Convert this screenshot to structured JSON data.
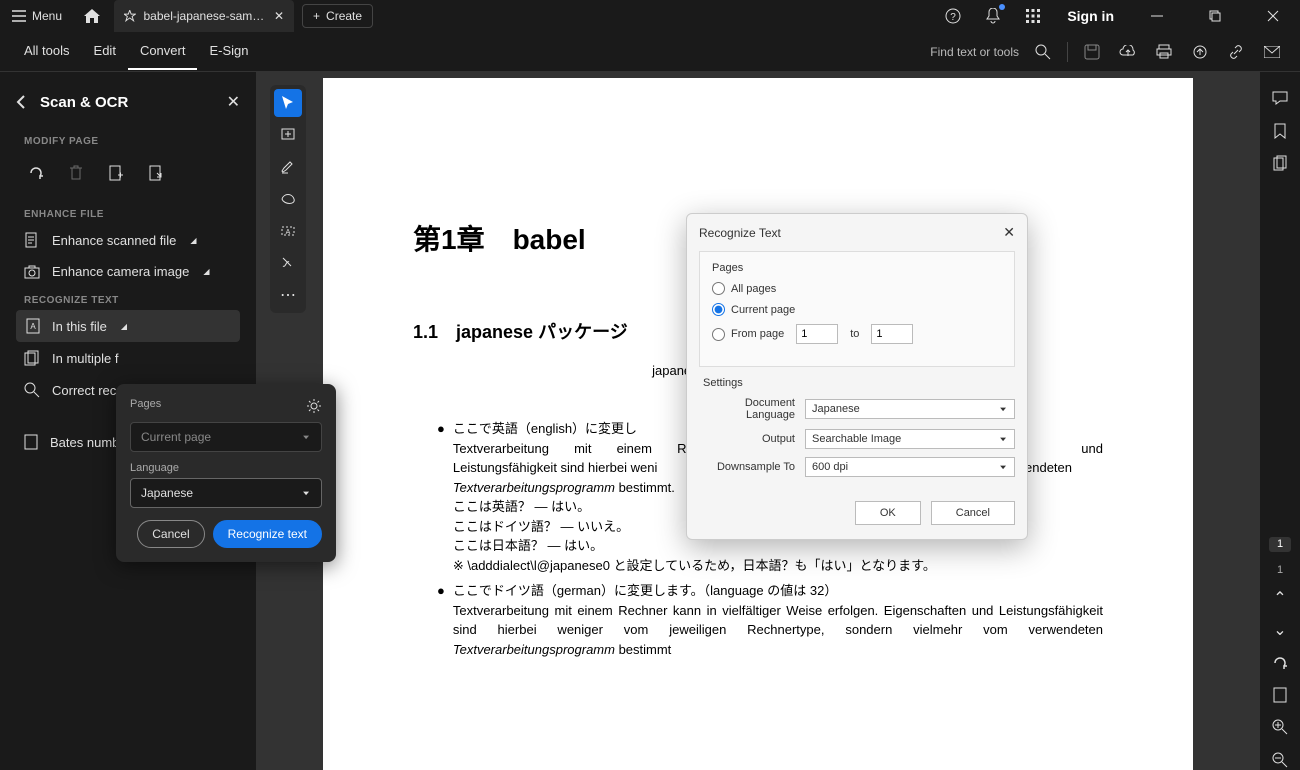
{
  "titlebar": {
    "menu": "Menu",
    "tab_title": "babel-japanese-sample.",
    "create": "Create",
    "signin": "Sign in"
  },
  "toolbar": {
    "tabs": [
      "All tools",
      "Edit",
      "Convert",
      "E-Sign"
    ],
    "find": "Find text or tools"
  },
  "sidebar": {
    "title": "Scan & OCR",
    "modify_label": "MODIFY PAGE",
    "enhance_label": "ENHANCE FILE",
    "enhance_scanned": "Enhance scanned file",
    "enhance_camera": "Enhance camera image",
    "recognize_label": "RECOGNIZE TEXT",
    "in_this_file": "In this file",
    "in_multiple": "In multiple f",
    "correct": "Correct reco",
    "bates": "Bates numb"
  },
  "popup": {
    "pages_label": "Pages",
    "pages_value": "Current page",
    "language_label": "Language",
    "language_value": "Japanese",
    "cancel": "Cancel",
    "recognize": "Recognize text"
  },
  "dialog": {
    "title": "Recognize Text",
    "pages_label": "Pages",
    "all_pages": "All pages",
    "current_page": "Current page",
    "from_page": "From page",
    "from_value": "1",
    "to": "to",
    "to_value": "1",
    "settings_label": "Settings",
    "doc_lang_label": "Document Language",
    "doc_lang_value": "Japanese",
    "output_label": "Output",
    "output_value": "Searchable Image",
    "downsample_label": "Downsample To",
    "downsample_value": "600 dpi",
    "ok": "OK",
    "cancel": "Cancel"
  },
  "document": {
    "page_number": "1",
    "h1": "第1章　babel",
    "h2": "1.1　japanese パッケージ",
    "intro": "japanese パッケージは日本語による",
    "b1_head": "ここで英語（english）に変更し",
    "b1_body1": "Textverarbeitung mit einem R",
    "b1_body1b": "und Leistungsfähigkeit sind hierbei weni",
    "b1_body1c": "wendeten",
    "b1_ital": "Textverarbeitungsprogramm",
    "b1_rest": " bestimmt.",
    "b1_q1": "ここは英語？ — はい。",
    "b1_q2": "ここはドイツ語？ — いいえ。",
    "b1_q3": "ここは日本語？ — はい。",
    "b1_note": "※ \\adddialect\\l@japanese0 と設定しているため，日本語？も「はい」となります。",
    "b2_head": "ここでドイツ語（german）に変更します。（language の値は 32）",
    "b2_body1": "Textverarbeitung mit einem Rechner kann in vielfältiger Weise erfolgen. Eigenschaften und Leistungsfähigkeit sind hierbei weniger vom jeweiligen Rechnertype, sondern vielmehr vom verwendeten ",
    "b2_ital": "Textverarbeitungsprogramm",
    "b2_rest": " bestimmt"
  },
  "rightrail": {
    "current": "1",
    "total": "1"
  }
}
